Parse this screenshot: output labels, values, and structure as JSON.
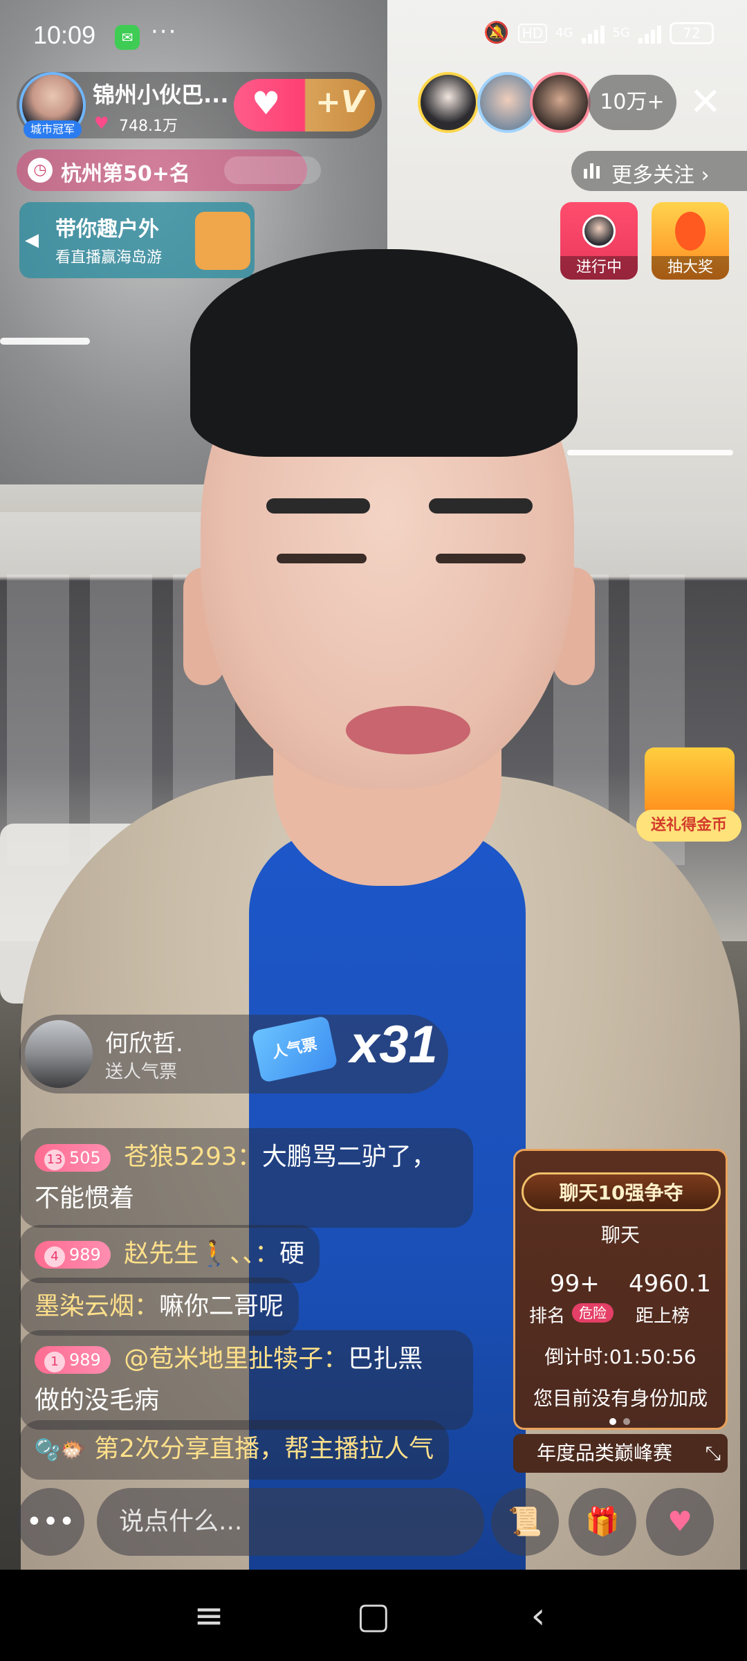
{
  "status_bar": {
    "time": "10:09",
    "more": "···",
    "network_1": "4G",
    "network_2": "5G",
    "hd": "HD",
    "battery": "72"
  },
  "host": {
    "name": "锦州小伙巴...",
    "popularity": "748.1万",
    "badge": "城市冠军"
  },
  "viewers": {
    "count": "10万+"
  },
  "rank": {
    "text": "杭州第50+名"
  },
  "more_follow": "更多关注 ›",
  "promo": {
    "title": "带你趣户外",
    "subtitle": "看直播赢海岛游"
  },
  "mini_cards": {
    "ongoing": "进行中",
    "lottery": "抽大奖"
  },
  "treasure_label": "送礼得金币",
  "gift_popup": {
    "name": "何欣哲.",
    "action": "送人气票",
    "gift_label": "人气票",
    "combo": "x31"
  },
  "chat": [
    {
      "level_num": "13",
      "level": "505",
      "user": "苍狼5293：",
      "text": "大鹏骂二驴了，",
      "text2": "不能惯着"
    },
    {
      "level_num": "4",
      "level": "989",
      "user": "赵先生🚶、、：",
      "text": "硬"
    },
    {
      "user": "墨染云烟：",
      "text": "嘛你二哥呢"
    },
    {
      "level_num": "1",
      "level": "989",
      "user": "@苞米地里扯犊子：",
      "text": "巴扎黑",
      "text2": "做的没毛病"
    },
    {
      "system": "第2次分享直播，帮主播拉人气"
    }
  ],
  "panel": {
    "title": "聊天10强争夺",
    "category": "聊天",
    "rank_value": "99+",
    "gap_value": "4960.1",
    "rank_label": "排名",
    "danger": "危险",
    "gap_label": "距上榜",
    "countdown": "倒计时:01:50:56",
    "identity": "您目前没有身份加成",
    "annual": "年度品类巅峰赛"
  },
  "bottom": {
    "more": "•••",
    "placeholder": "说点什么..."
  },
  "colors": {
    "accent_pink": "#ff3f74",
    "gold": "#e9a25b",
    "chat_name": "#ffe08a"
  }
}
